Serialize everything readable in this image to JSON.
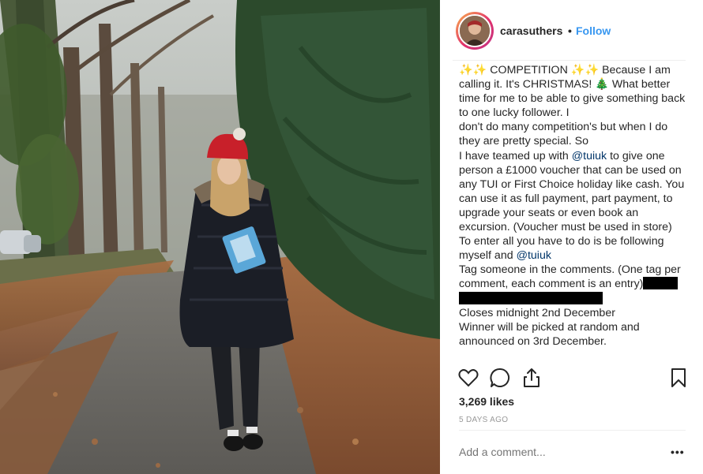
{
  "post": {
    "username": "carasuthers",
    "separator": "•",
    "follow_label": "Follow",
    "caption": {
      "sparkles": "✨✨",
      "competition": "COMPETITION",
      "p1": "Because I am calling it. It's CHRISTMAS!",
      "tree": "🎄",
      "p2": "What better time for me to be able to give something back to one lucky follower. I",
      "p3": "don't do many competition's but when I do they are pretty special. So",
      "p4_a": "I have teamed up with",
      "mention": "@tuiuk",
      "p4_b": "to give one person a £1000 voucher that can be used on any TUI or First Choice holiday like cash. You can use it as full payment, part payment, to upgrade your seats or even book an excursion. (Voucher must be used in store)",
      "p5": "To enter all you have to do is be following myself and",
      "p6": "Tag someone in the comments. (One tag per comment, each comment is an entry)",
      "p7": "Closes midnight 2nd December",
      "p8": "Winner will be picked at random and announced on 3rd December."
    },
    "likes": "3,269 likes",
    "time_ago": "5 DAYS AGO",
    "comment_placeholder": "Add a comment...",
    "more_label": "•••"
  },
  "icons": {
    "like": "heart-icon",
    "comment": "comment-icon",
    "share": "share-icon",
    "save": "bookmark-icon",
    "avatar": "avatar"
  },
  "colors": {
    "follow": "#3897f0",
    "mention": "#003569",
    "muted": "#999999",
    "text": "#262626"
  }
}
